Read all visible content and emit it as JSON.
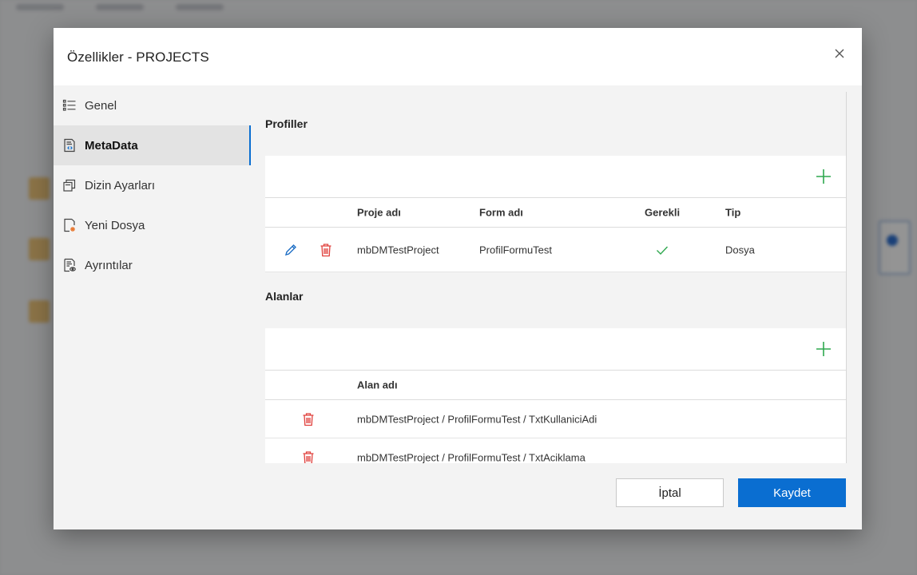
{
  "colors": {
    "accent": "#0a6ed1",
    "add_icon": "#2fa84f",
    "delete_icon": "#e0403c",
    "edit_icon": "#1f6fc5",
    "check_icon": "#2fa84f"
  },
  "dialog": {
    "title": "Özellikler - PROJECTS",
    "close_icon": "close-icon"
  },
  "sidebar": {
    "items": [
      {
        "label": "Genel",
        "icon": "list-icon",
        "active": false
      },
      {
        "label": "MetaData",
        "icon": "metadata-document-icon",
        "active": true
      },
      {
        "label": "Dizin Ayarları",
        "icon": "folder-copy-icon",
        "active": false
      },
      {
        "label": "Yeni Dosya",
        "icon": "new-file-icon",
        "active": false
      },
      {
        "label": "Ayrıntılar",
        "icon": "document-details-icon",
        "active": false
      }
    ]
  },
  "profiles": {
    "title": "Profiller",
    "add_icon": "plus-icon",
    "columns": [
      "Proje adı",
      "Form adı",
      "Gerekli",
      "Tip"
    ],
    "rows": [
      {
        "project": "mbDMTestProject",
        "form": "ProfilFormuTest",
        "required": true,
        "type": "Dosya"
      }
    ]
  },
  "fields": {
    "title": "Alanlar",
    "add_icon": "plus-icon",
    "columns": [
      "Alan adı"
    ],
    "rows": [
      {
        "name": "mbDMTestProject / ProfilFormuTest / TxtKullaniciAdi"
      },
      {
        "name": "mbDMTestProject / ProfilFormuTest / TxtAciklama"
      }
    ]
  },
  "footer": {
    "cancel_label": "İptal",
    "save_label": "Kaydet"
  }
}
